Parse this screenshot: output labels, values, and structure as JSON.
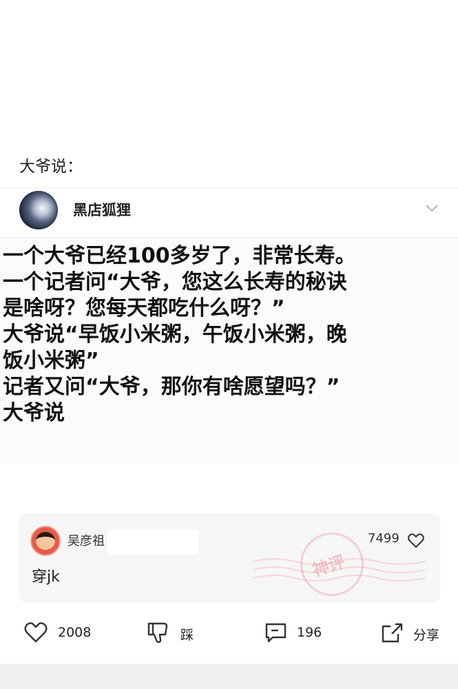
{
  "caption": "大爷说：",
  "post": {
    "author": "黑店狐狸",
    "lines": [
      "一个大爷已经100多岁了，非常长寿。",
      "一个记者问“大爷，您这么长寿的秘诀",
      "是啥呀？您每天都吃什么呀？”",
      "大爷说“早饭小米粥，午饭小米粥，晚",
      "饭小米粥”",
      "记者又问“大爷，那你有啥愿望吗？”",
      "大爷说"
    ]
  },
  "hot_comment": {
    "name": "吴彦祖",
    "likes": "7499",
    "text": "穿jk",
    "stamp": "神评"
  },
  "actions": {
    "like_count": "2008",
    "dislike_label": "踩",
    "comment_count": "196",
    "share_label": "分享"
  }
}
